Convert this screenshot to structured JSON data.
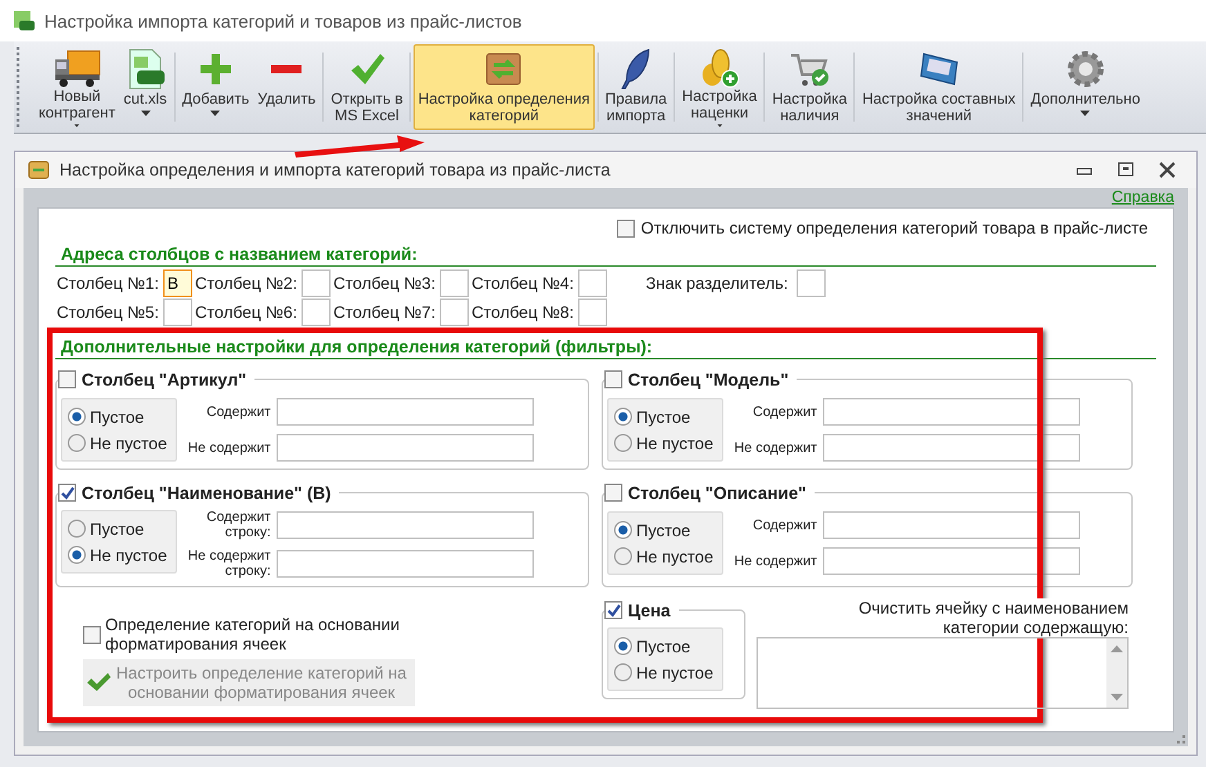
{
  "app": {
    "title": "Настройка импорта категорий и товаров из прайс-листов"
  },
  "toolbar": {
    "groups": [
      [
        {
          "label": "Новый\nконтрагент",
          "dropdown": true,
          "selected": false
        },
        {
          "label": "cut.xls\n",
          "dropdown": true,
          "selected": false
        }
      ],
      [
        {
          "label": "Добавить\n",
          "dropdown": true,
          "selected": false
        },
        {
          "label": "Удалить",
          "dropdown": false,
          "selected": false
        }
      ],
      [
        {
          "label": "Открыть в\nMS Excel",
          "dropdown": false,
          "selected": false
        }
      ],
      [
        {
          "label": "Настройка определения\nкатегорий",
          "dropdown": false,
          "selected": true
        }
      ],
      [
        {
          "label": "Правила\nимпорта",
          "dropdown": false,
          "selected": false
        }
      ],
      [
        {
          "label": "Настройка\nнаценки",
          "dropdown": true,
          "selected": false
        }
      ],
      [
        {
          "label": "Настройка\nналичия",
          "dropdown": false,
          "selected": false
        }
      ],
      [
        {
          "label": "Настройка составных\nзначений",
          "dropdown": false,
          "selected": false
        }
      ],
      [
        {
          "label": "Дополнительно\n",
          "dropdown": true,
          "selected": false
        }
      ]
    ]
  },
  "dialog": {
    "title": "Настройка определения и импорта категорий товара из прайс-листа",
    "help_link": "Справка",
    "disable_option": {
      "label": "Отключить систему определения категорий товара в прайс-листе",
      "checked": false
    },
    "columns_section": {
      "heading": "Адреса столбцов с названием категорий:",
      "columns": [
        {
          "label": "Столбец №1:",
          "value": "B",
          "focused": true
        },
        {
          "label": "Столбец №2:",
          "focused": false
        },
        {
          "label": "Столбец №3:",
          "focused": false
        },
        {
          "label": "Столбец №4:",
          "focused": false
        },
        {
          "label": "Столбец №5:",
          "focused": false
        },
        {
          "label": "Столбец №6:",
          "focused": false
        },
        {
          "label": "Столбец №7:",
          "focused": false
        },
        {
          "label": "Столбец №8:",
          "focused": false
        }
      ],
      "separator": {
        "label": "Знак разделитель:"
      }
    },
    "filters_section": {
      "heading": "Дополнительные настройки для определения категорий (фильтры):",
      "groups": [
        {
          "title": "Столбец \"Артикул\"",
          "checked": false,
          "options": [
            {
              "label": "Пустое",
              "selected": true
            },
            {
              "label": "Не пустое",
              "selected": false
            }
          ],
          "fields": [
            {
              "label": "Содержит"
            },
            {
              "label": "Не содержит"
            }
          ]
        },
        {
          "title": "Столбец \"Модель\"",
          "checked": false,
          "options": [
            {
              "label": "Пустое",
              "selected": true
            },
            {
              "label": "Не пустое",
              "selected": false
            }
          ],
          "fields": [
            {
              "label": "Содержит"
            },
            {
              "label": "Не содержит"
            }
          ]
        },
        {
          "title": "Столбец \"Наименование\" (B)",
          "checked": true,
          "options": [
            {
              "label": "Пустое",
              "selected": false
            },
            {
              "label": "Не пустое",
              "selected": true
            }
          ],
          "fields": [
            {
              "label": "Содержит\nстроку:"
            },
            {
              "label": "Не содержит\nстроку:"
            }
          ]
        },
        {
          "title": "Столбец \"Описание\"",
          "checked": false,
          "options": [
            {
              "label": "Пустое",
              "selected": true
            },
            {
              "label": "Не пустое",
              "selected": false
            }
          ],
          "fields": [
            {
              "label": "Содержит"
            },
            {
              "label": "Не содержит"
            }
          ]
        }
      ],
      "format_option": {
        "label": "Определение категорий на основании\nформатирования ячеек",
        "checked": false
      },
      "format_button": {
        "label": "Настроить определение категорий на\nосновании форматирования ячеек",
        "disabled": true
      },
      "price_group": {
        "title": "Цена",
        "checked": true,
        "options": [
          {
            "label": "Пустое",
            "selected": true
          },
          {
            "label": "Не пустое",
            "selected": false
          }
        ]
      },
      "clear_field": {
        "label": "Очистить ячейку с наименованием\nкатегории содержащую:"
      }
    }
  }
}
